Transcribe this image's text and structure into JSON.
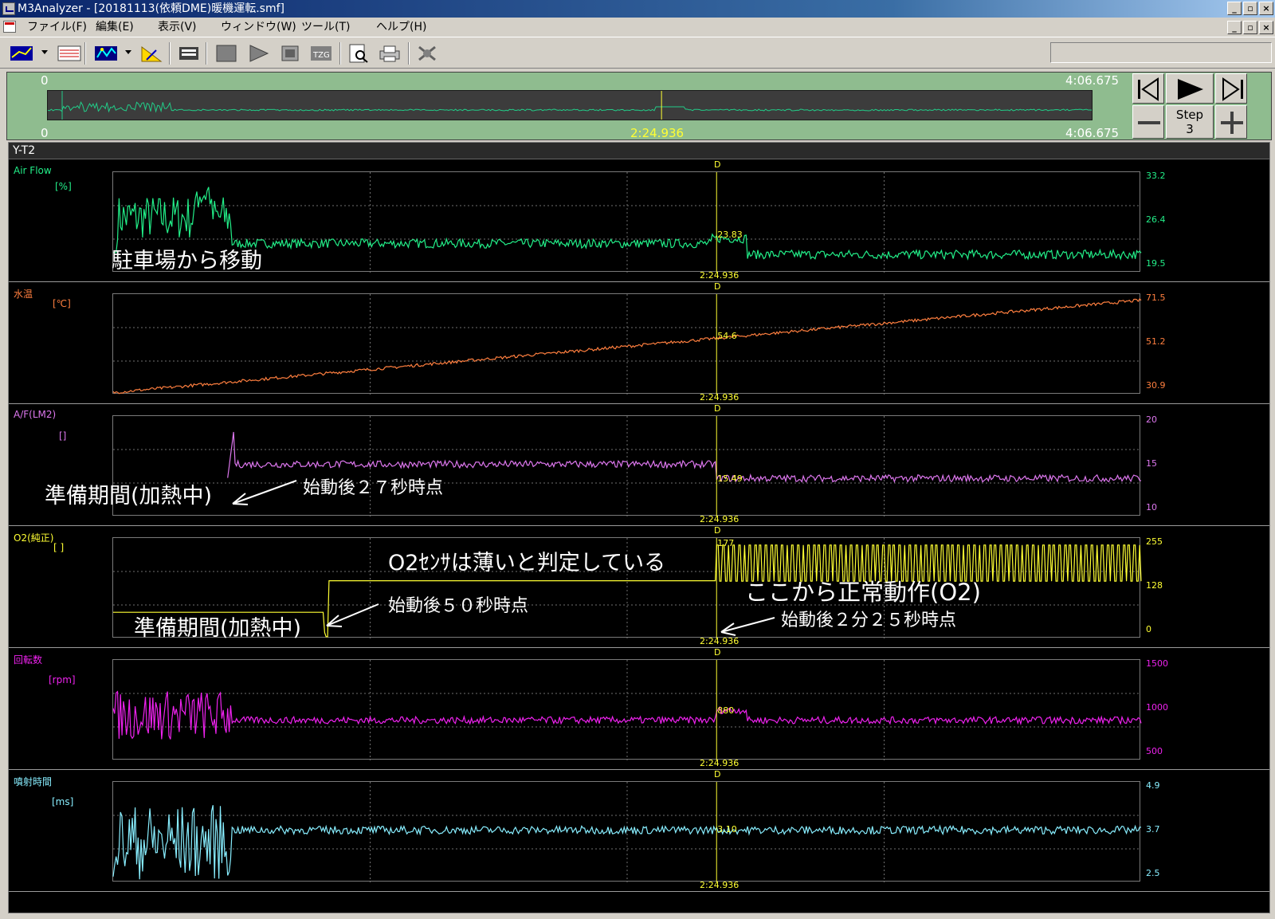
{
  "window": {
    "title": "M3Analyzer - [20181113(依頼DME)暖機運転.smf]",
    "min_glyph": "_",
    "restore_glyph": "▫",
    "close_glyph": "×"
  },
  "menu": [
    "ファイル(F)",
    "編集(E)",
    "表示(V)",
    "ウィンドウ(W)",
    "ツール(T)",
    "ヘルプ(H)"
  ],
  "toolbar": {
    "icons": [
      "yt-chart-icon",
      "waveform-icon",
      "xy-chart-icon",
      "measure-icon",
      "database-icon",
      "gray-box-icon",
      "gray-flag-icon",
      "gray-square-icon",
      "tzg-icon",
      "preview-icon",
      "print-icon",
      "disconnect-icon"
    ]
  },
  "overview": {
    "start_top": "0",
    "end_top": "4:06.675",
    "start_bottom": "0",
    "cursor_time": "2:24.936",
    "end_bottom": "4:06.675",
    "cursor_fraction": 0.587,
    "step_label": "Step",
    "step_value": "3"
  },
  "yt": {
    "header": "Y-T2",
    "cursor_label": "D",
    "cursor_time": "2:24.936",
    "cursor_fraction": 0.587
  },
  "channels": [
    {
      "name": "Air Flow",
      "unit": "[%]",
      "color": "#22ee88",
      "ticks": [
        "33.2",
        "26.4",
        "19.5"
      ],
      "range": [
        19.5,
        33.2
      ],
      "value_at_cursor": "23.83",
      "profile": "airflow"
    },
    {
      "name": "水温",
      "unit": "[℃]",
      "color": "#ff7f3f",
      "ticks": [
        "71.5",
        "51.2",
        "30.9"
      ],
      "range": [
        30.9,
        71.5
      ],
      "value_at_cursor": "54.6",
      "profile": "watertemp"
    },
    {
      "name": "A/F(LM2)",
      "unit": "[]",
      "color": "#dd77ee",
      "ticks": [
        "20",
        "15",
        "10"
      ],
      "range": [
        10,
        20
      ],
      "value_at_cursor": "15.49",
      "profile": "af"
    },
    {
      "name": "O2(純正)",
      "unit": "[ ]",
      "color": "#ffff33",
      "ticks": [
        "255",
        "128",
        "0"
      ],
      "range": [
        0,
        255
      ],
      "value_at_cursor": "177",
      "profile": "o2"
    },
    {
      "name": "回転数",
      "unit": "[rpm]",
      "color": "#ee22ee",
      "ticks": [
        "1500",
        "1000",
        "500"
      ],
      "range": [
        500,
        1500
      ],
      "value_at_cursor": "880",
      "profile": "rpm"
    },
    {
      "name": "噴射時間",
      "unit": "[ms]",
      "color": "#88eeff",
      "ticks": [
        "4.9",
        "3.7",
        "2.5"
      ],
      "range": [
        2.5,
        4.9
      ],
      "value_at_cursor": "3.10",
      "profile": "inj"
    }
  ],
  "annotations": {
    "parking": "駐車場から移動",
    "af_prep": "準備期間(加熱中)",
    "af_start": "始動後２７秒時点",
    "o2_lean": "O2ｾﾝｻは薄いと判定している",
    "o2_normal": "ここから正常動作(O2)",
    "o2_start50": "始動後５０秒時点",
    "o2_prep": "準備期間(加熱中)",
    "o2_start225": "始動後２分２５秒時点"
  },
  "colors": {
    "annotation": "#ffffff",
    "cursor": "#ffff33",
    "grid": "#707070"
  }
}
